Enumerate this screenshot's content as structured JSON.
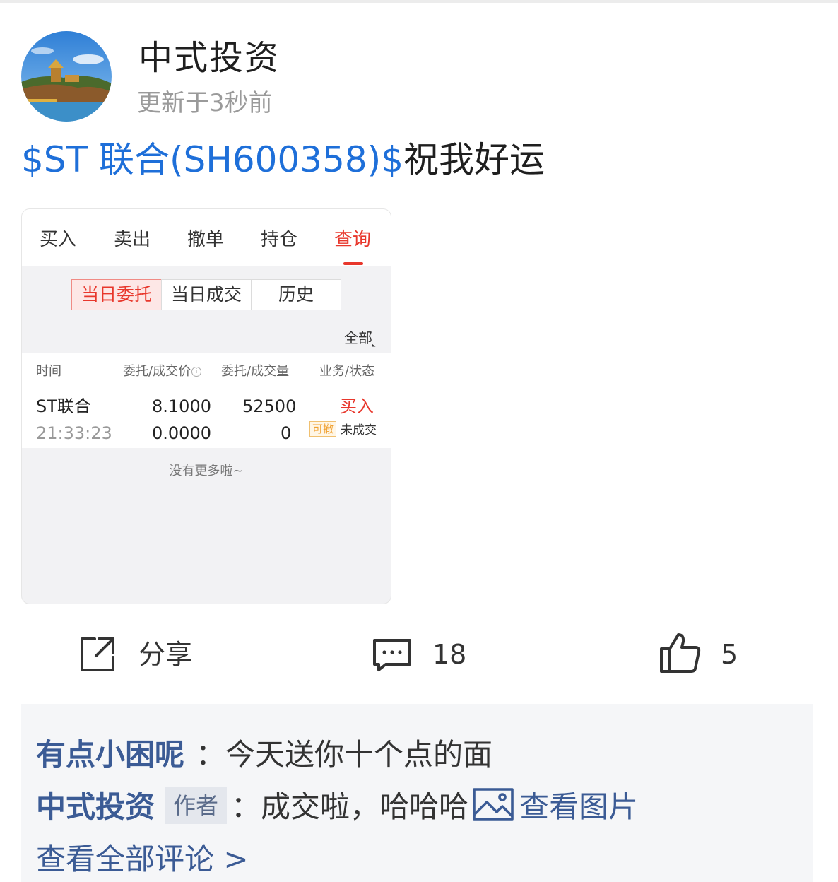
{
  "post": {
    "author": "中式投资",
    "updated": "更新于3秒前",
    "stock_link": "$ST 联合(SH600358)$",
    "text": "祝我好运"
  },
  "screenshot": {
    "tabs": [
      "买入",
      "卖出",
      "撤单",
      "持仓",
      "查询"
    ],
    "active_tab": "查询",
    "segments": [
      "当日委托",
      "当日成交",
      "历史"
    ],
    "active_segment": "当日委托",
    "filter": "全部",
    "columns": [
      "时间",
      "委托/成交价",
      "委托/成交量",
      "业务/状态"
    ],
    "row": {
      "name": "ST联合",
      "time": "21:33:23",
      "price": "8.1000",
      "deal_price": "0.0000",
      "volume": "52500",
      "deal_volume": "0",
      "action": "买入",
      "badge": "可撤",
      "status": "未成交"
    },
    "no_more": "没有更多啦~"
  },
  "actions": {
    "share_label": "分享",
    "comment_count": "18",
    "like_count": "5",
    "icons": [
      "share-icon",
      "comment-icon",
      "like-icon"
    ]
  },
  "comments": {
    "items": [
      {
        "name": "有点小困呢",
        "sep": "：",
        "text": "今天送你十个点的面"
      },
      {
        "name": "中式投资",
        "tag": "作者",
        "sep": "：",
        "text": "成交啦，哈哈哈",
        "view_image": "查看图片"
      }
    ],
    "view_all": "查看全部评论 >"
  },
  "colors": {
    "link_blue": "#1e6fd9",
    "comment_name": "#3b5b95",
    "accent_red": "#e8372c"
  }
}
